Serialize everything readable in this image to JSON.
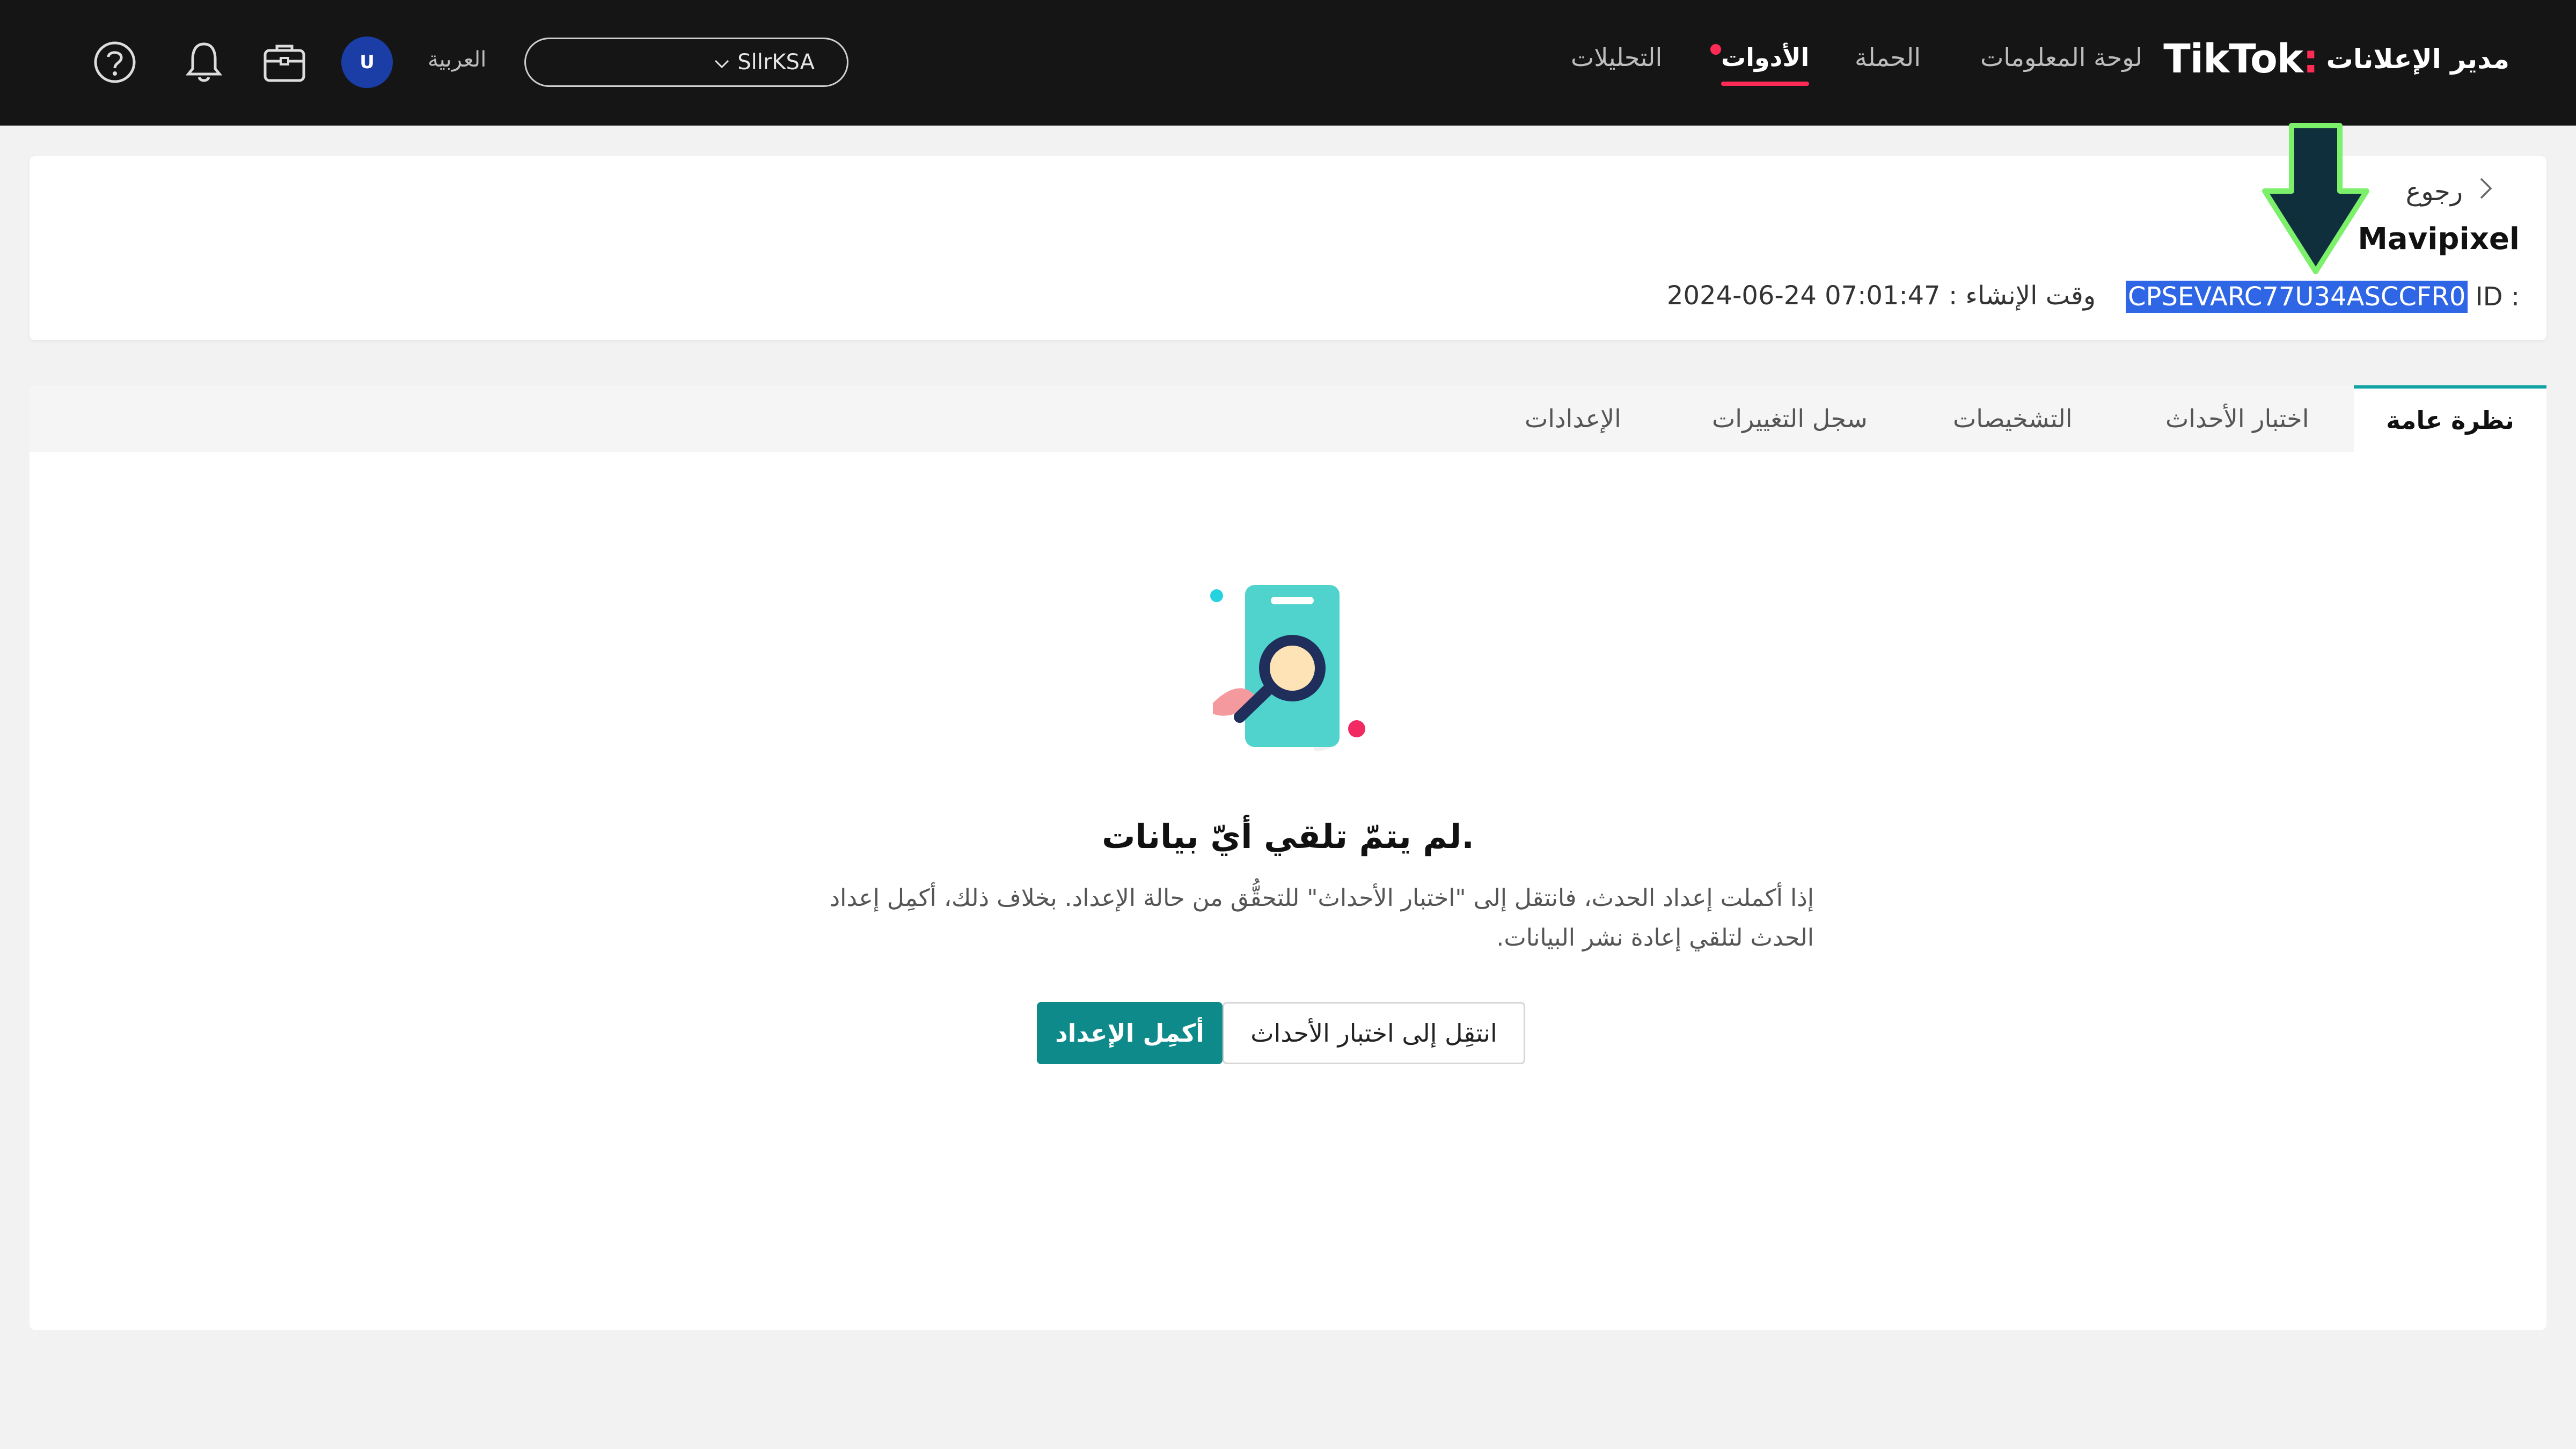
{
  "topbar": {
    "brand_name": "TikTok",
    "brand_subtitle": "مدير الإعلانات",
    "nav": [
      {
        "label": "لوحة المعلومات"
      },
      {
        "label": "الحملة"
      },
      {
        "label": "الأدوات"
      },
      {
        "label": "التحليلات"
      }
    ],
    "account_name": "SllrKSA",
    "language": "العربية",
    "avatar_letter": "U",
    "icons": [
      "help-icon",
      "bell-icon",
      "briefcase-icon"
    ],
    "accent_color": "#fe2c55"
  },
  "header": {
    "back_label": "رجوع",
    "pixel_name": "Mavipixel",
    "id_label": "ID :",
    "id_value": "CPSEVARC77U34ASCCFR0",
    "created_label": "وقت الإنشاء :",
    "created_value": "2024-06-24 07:01:47"
  },
  "tabs": [
    {
      "label": "نظرة عامة",
      "active": true
    },
    {
      "label": "اختبار الأحداث"
    },
    {
      "label": "التشخيصات"
    },
    {
      "label": "سجل التغييرات"
    },
    {
      "label": "الإعدادات"
    }
  ],
  "empty_state": {
    "title": "لم يتمّ تلقي أيّ بيانات.",
    "description": "إذا أكملت إعداد الحدث، فانتقل إلى \"اختبار الأحداث\" للتحقُّق من حالة الإعداد. بخلاف ذلك، أكمِل إعداد الحدث لتلقي إعادة نشر البيانات.",
    "primary_button": "أكمِل الإعداد",
    "secondary_button": "انتقِل إلى اختبار الأحداث",
    "primary_color": "#0e8a8a"
  }
}
